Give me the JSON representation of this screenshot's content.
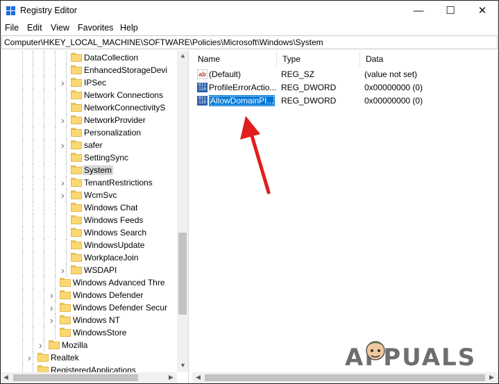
{
  "window": {
    "title": "Registry Editor",
    "controls": {
      "minimize": "—",
      "maximize": "☐",
      "close": "✕"
    }
  },
  "menu": {
    "items": [
      "File",
      "Edit",
      "View",
      "Favorites",
      "Help"
    ]
  },
  "address": {
    "path": "Computer\\HKEY_LOCAL_MACHINE\\SOFTWARE\\Policies\\Microsoft\\Windows\\System"
  },
  "tree": {
    "items": [
      {
        "label": "DataCollection",
        "expandable": false
      },
      {
        "label": "EnhancedStorageDevi",
        "expandable": false
      },
      {
        "label": "IPSec",
        "expandable": true
      },
      {
        "label": "Network Connections",
        "expandable": false
      },
      {
        "label": "NetworkConnectivityS",
        "expandable": false
      },
      {
        "label": "NetworkProvider",
        "expandable": true
      },
      {
        "label": "Personalization",
        "expandable": false
      },
      {
        "label": "safer",
        "expandable": true
      },
      {
        "label": "SettingSync",
        "expandable": false
      },
      {
        "label": "System",
        "expandable": false,
        "selected": true
      },
      {
        "label": "TenantRestrictions",
        "expandable": true
      },
      {
        "label": "WcmSvc",
        "expandable": true
      },
      {
        "label": "Windows Chat",
        "expandable": false
      },
      {
        "label": "Windows Feeds",
        "expandable": false
      },
      {
        "label": "Windows Search",
        "expandable": false
      },
      {
        "label": "WindowsUpdate",
        "expandable": false
      },
      {
        "label": "WorkplaceJoin",
        "expandable": false
      },
      {
        "label": "WSDAPI",
        "expandable": true
      },
      {
        "label": "Windows Advanced Thre",
        "expandable": false
      },
      {
        "label": "Windows Defender",
        "expandable": true
      },
      {
        "label": "Windows Defender Secur",
        "expandable": true
      },
      {
        "label": "Windows NT",
        "expandable": true
      },
      {
        "label": "WindowsStore",
        "expandable": false
      },
      {
        "label": "Mozilla",
        "expandable": true
      },
      {
        "label": "Realtek",
        "expandable": true
      },
      {
        "label": "RegisteredApplications",
        "expandable": false
      }
    ]
  },
  "list": {
    "columns": [
      "Name",
      "Type",
      "Data"
    ],
    "rows": [
      {
        "icon": "string-value-icon",
        "glyph": "ab",
        "name": "(Default)",
        "type": "REG_SZ",
        "data": "(value not set)",
        "selected": false
      },
      {
        "icon": "dword-value-icon",
        "glyph": "011 110",
        "name": "ProfileErrorActio...",
        "type": "REG_DWORD",
        "data": "0x00000000 (0)",
        "selected": false
      },
      {
        "icon": "dword-value-icon",
        "glyph": "011 110",
        "name": "AllowDomainPI...",
        "type": "REG_DWORD",
        "data": "0x00000000 (0)",
        "selected": true
      }
    ]
  },
  "colors": {
    "selection": "#0078d7",
    "annotation_arrow": "#e01e1e",
    "folder": "#fbd872"
  },
  "watermark": {
    "text": "APPUALS"
  }
}
